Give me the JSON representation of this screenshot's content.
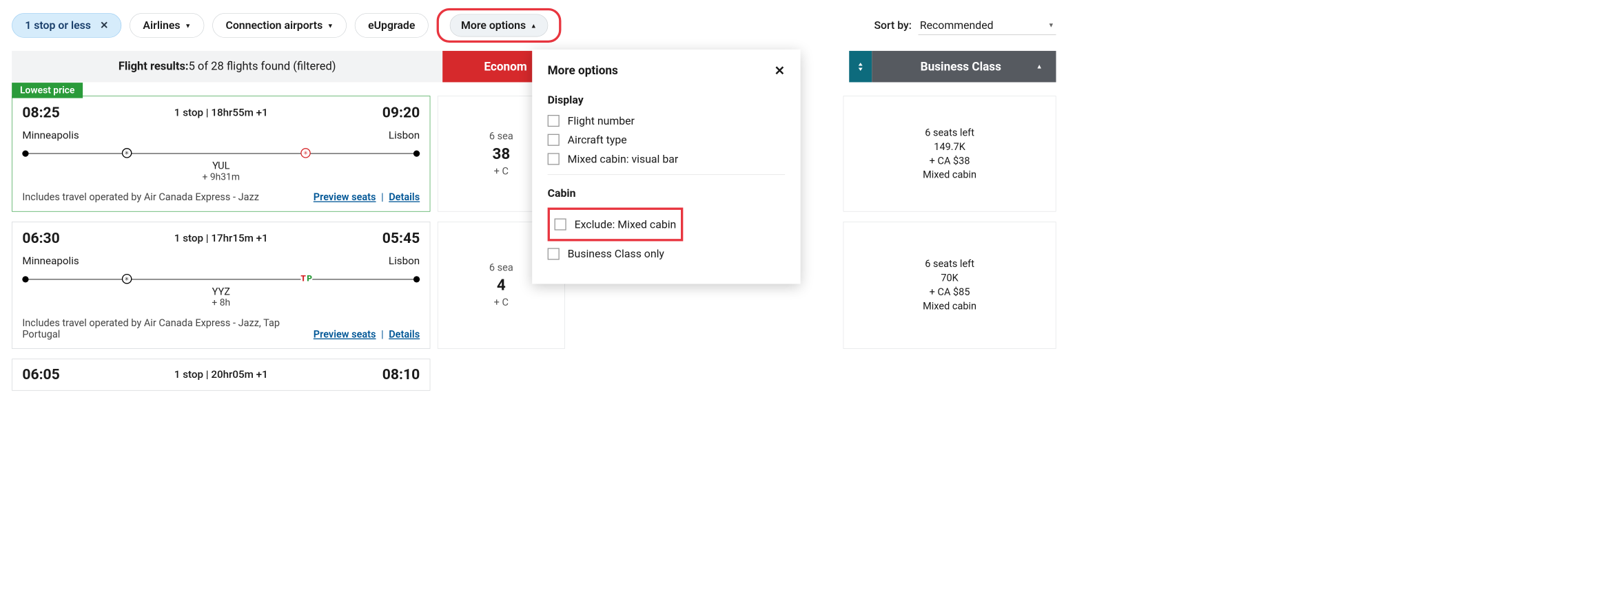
{
  "filters": {
    "stop": "1 stop or less",
    "airlines": "Airlines",
    "conn": "Connection airports",
    "eupgrade": "eUpgrade",
    "more": "More options"
  },
  "sort": {
    "label": "Sort by:",
    "value": "Recommended"
  },
  "results": {
    "label": "Flight results:",
    "text": "5 of 28 flights found (filtered)"
  },
  "tabs": {
    "economy": "Econom",
    "business": "Business Class"
  },
  "lowbadge": "Lowest price",
  "popover": {
    "title": "More options",
    "display": "Display",
    "fn": "Flight number",
    "ac": "Aircraft type",
    "mc": "Mixed cabin: visual bar",
    "cabin": "Cabin",
    "ex": "Exclude: Mixed cabin",
    "bo": "Business Class only"
  },
  "flights": [
    {
      "dep": "08:25",
      "arr": "09:20",
      "mid": "1 stop | 18hr55m +1",
      "from": "Minneapolis",
      "to": "Lisbon",
      "connCode": "YUL",
      "connLay": "+ 9h31m",
      "op": "Includes travel operated by Air Canada Express - Jazz",
      "preview": "Preview seats",
      "details": "Details",
      "econ": {
        "seats": "6 sea",
        "pts": "38",
        "plus": "+ C"
      },
      "biz": {
        "seats": "6 seats left",
        "pts": "149.7K",
        "plus": "+ CA $38",
        "mixed": "Mixed cabin"
      },
      "logo2": "maple"
    },
    {
      "dep": "06:30",
      "arr": "05:45",
      "mid": "1 stop | 17hr15m +1",
      "from": "Minneapolis",
      "to": "Lisbon",
      "connCode": "YYZ",
      "connLay": "+ 8h",
      "op": "Includes travel operated by Air Canada Express - Jazz, Tap Portugal",
      "preview": "Preview seats",
      "details": "Details",
      "econ": {
        "seats": "6 sea",
        "pts": "4",
        "plus": "+ C"
      },
      "biz": {
        "seats": "6 seats left",
        "pts": "70K",
        "plus": "+ CA $85",
        "mixed": "Mixed cabin"
      },
      "logo2": "tap"
    },
    {
      "dep": "06:05",
      "arr": "08:10",
      "mid": "1 stop | 20hr05m +1"
    }
  ]
}
